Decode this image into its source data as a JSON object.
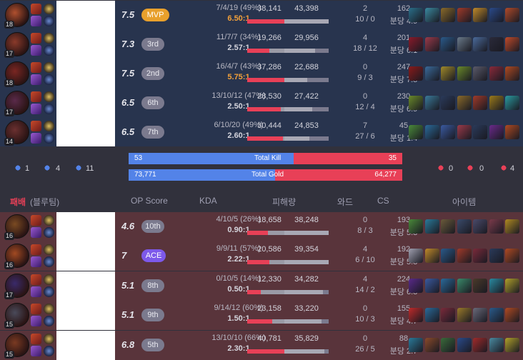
{
  "win_team": {
    "players": [
      {
        "level": "18",
        "score": "7.5",
        "badge": "MVP",
        "badge_type": "mvp",
        "kda": "7/4/19 (49%)",
        "ratio": "6.50:1",
        "ratio_hi": true,
        "dealt": "38,141",
        "dealt_pct": 1.0,
        "taken": "43,398",
        "taken_pct": 1.0,
        "ward_top": "2",
        "ward_bot": "10 / 0",
        "cs_top": "162",
        "cs_bot": "분당 4.9",
        "champ_color": "#b0502e"
      },
      {
        "level": "17",
        "score": "7.3",
        "badge": "3rd",
        "badge_type": "",
        "kda": "11/7/7 (34%)",
        "ratio": "2.57:1",
        "ratio_hi": false,
        "dealt": "19,266",
        "dealt_pct": 0.5,
        "taken": "29,956",
        "taken_pct": 0.69,
        "ward_top": "4",
        "ward_bot": "18 / 12",
        "cs_top": "201",
        "cs_bot": "분당 6.1",
        "champ_color": "#8a3a2a"
      },
      {
        "level": "18",
        "score": "7.5",
        "badge": "2nd",
        "badge_type": "",
        "kda": "16/4/7 (43%)",
        "ratio": "5.75:1",
        "ratio_hi": true,
        "dealt": "37,286",
        "dealt_pct": 0.98,
        "taken": "22,688",
        "taken_pct": 0.52,
        "ward_top": "0",
        "ward_bot": "9 / 3",
        "cs_top": "247",
        "cs_bot": "분당 7.5",
        "champ_color": "#7a2622"
      },
      {
        "level": "17",
        "score": "6.5",
        "badge": "6th",
        "badge_type": "",
        "kda": "13/10/12 (47%)",
        "ratio": "2.50:1",
        "ratio_hi": false,
        "dealt": "28,530",
        "dealt_pct": 0.75,
        "taken": "27,422",
        "taken_pct": 0.63,
        "ward_top": "0",
        "ward_bot": "12 / 4",
        "cs_top": "230",
        "cs_bot": "분당 6.9",
        "champ_color": "#5a2a4a"
      },
      {
        "level": "14",
        "score": "6.5",
        "badge": "7th",
        "badge_type": "",
        "kda": "6/10/20 (49%)",
        "ratio": "2.60:1",
        "ratio_hi": false,
        "dealt": "30,444",
        "dealt_pct": 0.8,
        "taken": "24,853",
        "taken_pct": 0.57,
        "ward_top": "7",
        "ward_bot": "27 / 6",
        "cs_top": "45",
        "cs_bot": "분당 1.4",
        "champ_color": "#6a3030"
      }
    ]
  },
  "summary": {
    "blue_obj": [
      "1",
      "4",
      "11"
    ],
    "red_obj": [
      "0",
      "0",
      "4"
    ],
    "kill_blue": "53",
    "kill_label": "Total Kill",
    "kill_red": "35",
    "kill_blue_pct": 0.602,
    "gold_blue": "73,771",
    "gold_label": "Total Gold",
    "gold_red": "64,277",
    "gold_blue_pct": 0.534
  },
  "header": {
    "result": "패배",
    "team": "(블루팀)",
    "op_score": "OP Score",
    "kda": "KDA",
    "damage": "피해량",
    "ward": "와드",
    "cs": "CS",
    "items": "아이템"
  },
  "lose_team": {
    "players": [
      {
        "level": "16",
        "score": "4.6",
        "badge": "10th",
        "badge_type": "",
        "kda": "4/10/5 (26%)",
        "ratio": "0.90:1",
        "ratio_hi": false,
        "dealt": "18,658",
        "dealt_pct": 0.46,
        "taken": "38,248",
        "taken_pct": 1.0,
        "ward_top": "0",
        "ward_bot": "8 / 3",
        "cs_top": "193",
        "cs_bot": "분당 5.8",
        "champ_color": "#7a4a22"
      },
      {
        "level": "16",
        "score": "7",
        "badge": "ACE",
        "badge_type": "ace",
        "kda": "9/9/11 (57%)",
        "ratio": "2.22:1",
        "ratio_hi": false,
        "dealt": "20,586",
        "dealt_pct": 0.5,
        "taken": "39,354",
        "taken_pct": 1.0,
        "ward_top": "4",
        "ward_bot": "6 / 10",
        "cs_top": "192",
        "cs_bot": "분당 5.8",
        "champ_color": "#a24a22"
      },
      {
        "level": "17",
        "score": "5.1",
        "badge": "8th",
        "badge_type": "",
        "kda": "0/10/5 (14%)",
        "ratio": "0.50:1",
        "ratio_hi": false,
        "dealt": "12,330",
        "dealt_pct": 0.3,
        "taken": "34,282",
        "taken_pct": 0.87,
        "ward_top": "4",
        "ward_bot": "14 / 2",
        "cs_top": "224",
        "cs_bot": "분당 6.8",
        "champ_color": "#3a2a6a"
      },
      {
        "level": "15",
        "score": "5.1",
        "badge": "9th",
        "badge_type": "",
        "kda": "9/14/12 (60%)",
        "ratio": "1.50:1",
        "ratio_hi": false,
        "dealt": "23,158",
        "dealt_pct": 0.57,
        "taken": "33,220",
        "taken_pct": 0.84,
        "ward_top": "0",
        "ward_bot": "10 / 3",
        "cs_top": "155",
        "cs_bot": "분당 4.7",
        "champ_color": "#4a4a5a"
      },
      {
        "level": "15",
        "score": "6.8",
        "badge": "5th",
        "badge_type": "",
        "kda": "13/10/10 (66%)",
        "ratio": "2.30:1",
        "ratio_hi": false,
        "dealt": "40,781",
        "dealt_pct": 1.0,
        "taken": "35,829",
        "taken_pct": 0.91,
        "ward_top": "0",
        "ward_bot": "26 / 5",
        "cs_top": "88",
        "cs_bot": "분당 2.7",
        "champ_color": "#7a3a22"
      }
    ]
  },
  "colors": {
    "win_bg": "#28344e",
    "loss_bg": "#59343b",
    "blue": "#5383e8",
    "red": "#e84057",
    "mvp": "#e8a02c",
    "ace": "#7d59ea"
  }
}
